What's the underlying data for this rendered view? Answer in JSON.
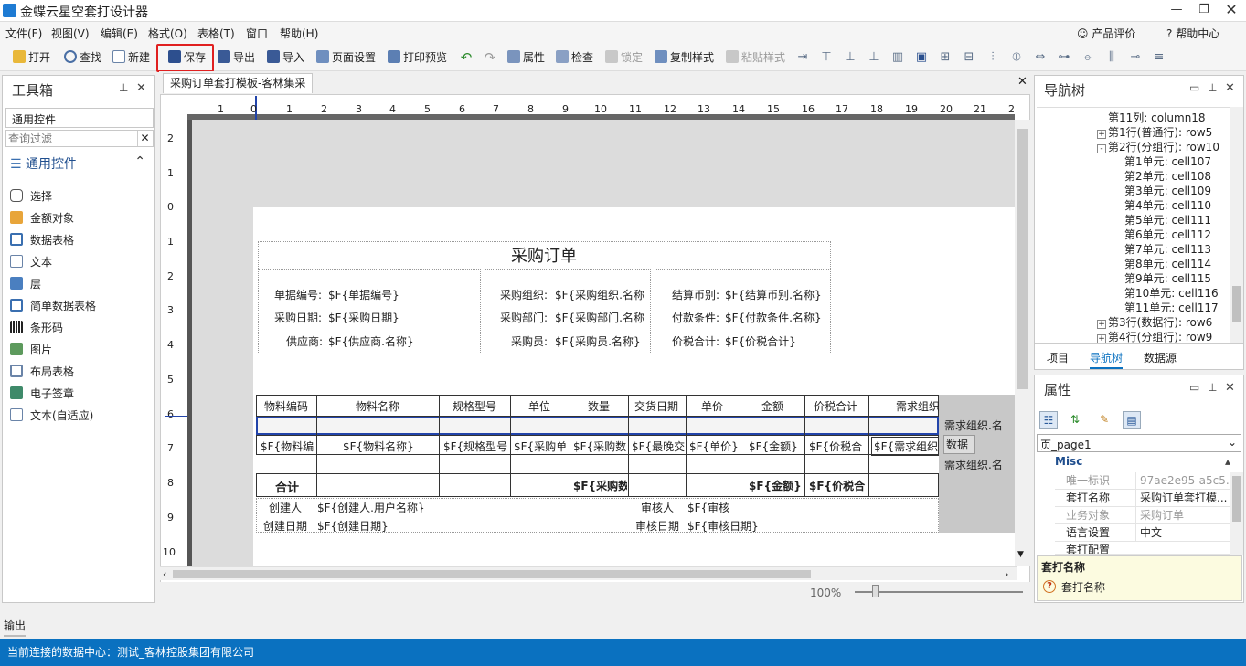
{
  "window": {
    "title": "金蝶云星空套打设计器"
  },
  "menu": [
    "文件(F)",
    "视图(V)",
    "编辑(E)",
    "格式(O)",
    "表格(T)",
    "窗口",
    "帮助(H)"
  ],
  "menu_right": {
    "rate": "产品评价",
    "help": "帮助中心"
  },
  "toolbar": {
    "open": "打开",
    "find": "查找",
    "new": "新建",
    "save": "保存",
    "export": "导出",
    "import": "导入",
    "page_setup": "页面设置",
    "print_preview": "打印预览",
    "properties": "属性",
    "check": "检查",
    "lock": "锁定",
    "copy_style": "复制样式",
    "paste_style": "粘贴样式"
  },
  "toolbox": {
    "title": "工具箱",
    "tab": "通用控件",
    "filter_placeholder": "查询过滤",
    "group": "通用控件",
    "items": [
      "选择",
      "金额对象",
      "数据表格",
      "文本",
      "层",
      "简单数据表格",
      "条形码",
      "图片",
      "布局表格",
      "电子签章",
      "文本(自适应)"
    ]
  },
  "doc_tab": "采购订单套打模板-客林集采",
  "ruler": {
    "h": [
      "1",
      "0",
      "1",
      "2",
      "3",
      "4",
      "5",
      "6",
      "7",
      "8",
      "9",
      "10",
      "11",
      "12",
      "13",
      "14",
      "15",
      "16",
      "17",
      "18",
      "19",
      "20",
      "21",
      "2"
    ],
    "v": [
      "2",
      "1",
      "0",
      "1",
      "2",
      "3",
      "4",
      "5",
      "6",
      "7",
      "8",
      "9",
      "10"
    ]
  },
  "report": {
    "title": "采购订单",
    "header_labels": [
      "单据编号:",
      "采购日期:",
      "供应商:",
      "采购组织:",
      "采购部门:",
      "采购员:",
      "结算币别:",
      "付款条件:",
      "价税合计:"
    ],
    "header_fields": [
      "$F{单据编号}",
      "$F{采购日期}",
      "$F{供应商.名称}",
      "$F{采购组织.名称",
      "$F{采购部门.名称",
      "$F{采购员.名称}",
      "$F{结算币别.名称}",
      "$F{付款条件.名称}",
      "$F{价税合计}"
    ],
    "columns": [
      "物料编码",
      "物料名称",
      "规格型号",
      "单位",
      "数量",
      "交货日期",
      "单价",
      "金额",
      "价税合计",
      "需求组织"
    ],
    "data_fields": [
      "$F{物料编",
      "$F{物料名称}",
      "$F{规格型号",
      "$F{采购单",
      "$F{采购数",
      "$F{最晚交",
      "$F{单价}",
      "$F{金额}",
      "$F{价税合",
      "$F{需求组织."
    ],
    "total_label": "合计",
    "totals": [
      "$F{采购数",
      "$F{金额}",
      "$F{价税合"
    ],
    "footer": {
      "creator_label": "创建人",
      "creator_field": "$F{创建人.用户名称}",
      "created_label": "创建日期",
      "created_field": "$F{创建日期}",
      "auditor_label": "审核人",
      "auditor_field": "$F{审核",
      "audit_date_label": "审核日期",
      "audit_date_field": "$F{审核日期}"
    },
    "overflow": [
      "需求组织.名",
      "数据",
      "需求组织.名"
    ]
  },
  "zoom": "100%",
  "navtree": {
    "title": "导航树",
    "rows": [
      {
        "text": "第11列: column18",
        "level": 3,
        "expander": ""
      },
      {
        "text": "第1行(普通行): row5",
        "level": 2,
        "expander": "+"
      },
      {
        "text": "第2行(分组行): row10",
        "level": 2,
        "expander": "-"
      },
      {
        "text": "第1单元: cell107",
        "level": 3,
        "expander": ""
      },
      {
        "text": "第2单元: cell108",
        "level": 3,
        "expander": ""
      },
      {
        "text": "第3单元: cell109",
        "level": 3,
        "expander": ""
      },
      {
        "text": "第4单元: cell110",
        "level": 3,
        "expander": ""
      },
      {
        "text": "第5单元: cell111",
        "level": 3,
        "expander": ""
      },
      {
        "text": "第6单元: cell112",
        "level": 3,
        "expander": ""
      },
      {
        "text": "第7单元: cell113",
        "level": 3,
        "expander": ""
      },
      {
        "text": "第8单元: cell114",
        "level": 3,
        "expander": ""
      },
      {
        "text": "第9单元: cell115",
        "level": 3,
        "expander": ""
      },
      {
        "text": "第10单元: cell116",
        "level": 3,
        "expander": ""
      },
      {
        "text": "第11单元: cell117",
        "level": 3,
        "expander": ""
      },
      {
        "text": "第3行(数据行): row6",
        "level": 2,
        "expander": "+"
      },
      {
        "text": "第4行(分组行): row9",
        "level": 2,
        "expander": "+"
      }
    ],
    "tabs": [
      "项目",
      "导航树",
      "数据源"
    ]
  },
  "properties": {
    "title": "属性",
    "object": "页_page1",
    "category": "Misc",
    "rows": [
      {
        "name": "唯一标识",
        "value": "97ae2e95-a5c5...",
        "disabled": true
      },
      {
        "name": "套打名称",
        "value": "采购订单套打模...",
        "disabled": false
      },
      {
        "name": "业务对象",
        "value": "采购订单",
        "disabled": true
      },
      {
        "name": "语言设置",
        "value": "中文",
        "disabled": false
      },
      {
        "name": "套打配置",
        "value": "",
        "disabled": false
      }
    ],
    "desc_title": "套打名称",
    "desc_text": "套打名称"
  },
  "output_label": "输出",
  "status": "当前连接的数据中心：测试_客林控股集团有限公司"
}
